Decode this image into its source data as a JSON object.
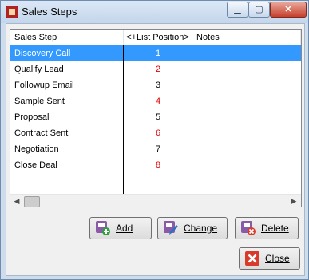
{
  "window": {
    "title": "Sales Steps"
  },
  "list": {
    "columns": [
      "Sales Step",
      "<+List Position>",
      "Notes"
    ],
    "rows": [
      {
        "step": "Discovery Call",
        "position": "1",
        "selected": true
      },
      {
        "step": "Qualify Lead",
        "position": "2"
      },
      {
        "step": "Followup Email",
        "position": "3"
      },
      {
        "step": "Sample Sent",
        "position": "4"
      },
      {
        "step": "Proposal",
        "position": "5"
      },
      {
        "step": "Contract Sent",
        "position": "6"
      },
      {
        "step": "Negotiation",
        "position": "7"
      },
      {
        "step": "Close Deal",
        "position": "8"
      }
    ]
  },
  "buttons": {
    "add": "Add",
    "change": "Change",
    "delete": "Delete",
    "close": "Close"
  },
  "colors": {
    "selection": "#3399ff",
    "even_position_text": "#e00000",
    "icon_purple": "#8a5aa8",
    "close_red": "#d93a2a"
  },
  "icons": {
    "add": "plus-icon",
    "change": "pencil-icon",
    "delete": "x-icon",
    "close": "close-x-icon"
  }
}
